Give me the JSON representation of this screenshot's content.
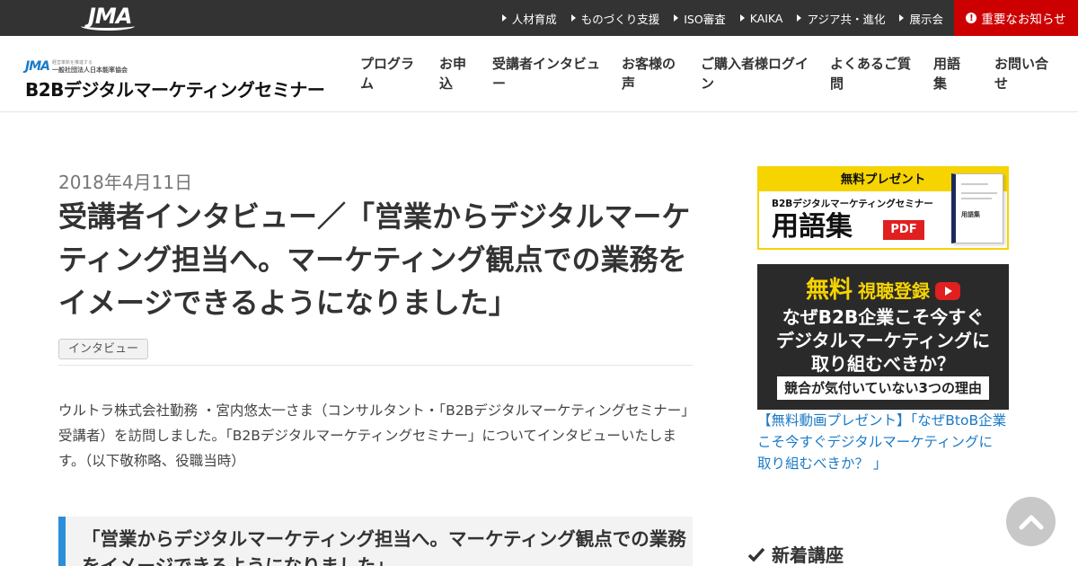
{
  "topbar": {
    "logo_text": "JMA",
    "links": [
      "人材育成",
      "ものづくり支援",
      "ISO審査",
      "KAIKA",
      "アジア共・進化",
      "展示会"
    ],
    "notice_label": "重要なお知らせ",
    "colors": {
      "bar": "#333333",
      "notice": "#cc0000"
    }
  },
  "header": {
    "logo_mark": "JMA",
    "logo_org": "一般社団法人日本能率協会",
    "logo_tagline": "経営革新を推進する",
    "site_name": "B2Bデジタルマーケティングセミナー",
    "nav": [
      "プログラム",
      "お申込",
      "受講者インタビュー",
      "お客様の声",
      "ご購入者様ログイン",
      "よくあるご質問",
      "用語集",
      "お問い合せ"
    ]
  },
  "article": {
    "date": "2018年4月11日",
    "title": "受講者インタビュー／「営業からデジタルマーケティング担当へ。マーケティング観点での業務をイメージできるようになりました」",
    "tag": "インタビュー",
    "intro": "ウルトラ株式会社勤務 ・宮内悠太一さま（コンサルタント・「B2Bデジタルマーケティングセミナー」受講者）を訪問しました。「B2Bデジタルマーケティングセミナー」についてインタビューいたします。（以下敬称略、役職当時）",
    "quote": "「営業からデジタルマーケティング担当へ。マーケティング観点での業務をイメージできるようになりました」",
    "accent_color": "#2a8fd8"
  },
  "sidebar": {
    "banner1": {
      "header": "無料プレゼント",
      "subtitle": "B2Bデジタルマーケティングセミナー",
      "big_text": "用語集",
      "pdf": "PDF",
      "book_title": "用語集"
    },
    "banner2": {
      "muryou": "無料",
      "shicho": "視聴登録",
      "line1": "なぜB2B企業こそ今すぐ",
      "line2": "デジタルマーケティングに",
      "line3": "取り組むべきか？",
      "footer": "競合が気付いていない3つの理由"
    },
    "link_text": "【無料動画プレゼント】「なぜBtoB企業こそ今すぐデジタルマーケティングに 取り組むべきか？ 」",
    "heading": "新着講座"
  }
}
